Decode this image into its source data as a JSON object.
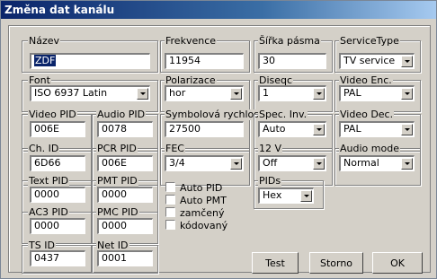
{
  "window": {
    "title": "Změna dat kanálu"
  },
  "fields": {
    "nazev": {
      "label": "Název",
      "value": "ZDF"
    },
    "frekvence": {
      "label": "Frekvence",
      "value": "11954"
    },
    "sirka": {
      "label": "Šířka pásma",
      "value": "30"
    },
    "servicetype": {
      "label": "ServiceType",
      "value": "TV service"
    },
    "font": {
      "label": "Font",
      "value": "ISO 6937 Latin"
    },
    "polarizace": {
      "label": "Polarizace",
      "value": "hor"
    },
    "diseqc": {
      "label": "Diseqc",
      "value": "1"
    },
    "videoenc": {
      "label": "Video Enc.",
      "value": "PAL"
    },
    "videopid": {
      "label": "Video PID",
      "value": "006E"
    },
    "audiopid": {
      "label": "Audio PID",
      "value": "0078"
    },
    "symbol": {
      "label": "Symbolová rychlost",
      "value": "27500"
    },
    "specinv": {
      "label": "Spec. Inv.",
      "value": "Auto"
    },
    "videodec": {
      "label": "Video Dec.",
      "value": "PAL"
    },
    "chid": {
      "label": "Ch. ID",
      "value": "6D66"
    },
    "pcrpid": {
      "label": "PCR PID",
      "value": "006E"
    },
    "fec": {
      "label": "FEC",
      "value": "3/4"
    },
    "v12": {
      "label": "12 V",
      "value": "Off"
    },
    "audiomode": {
      "label": "Audio mode",
      "value": "Normal"
    },
    "textpid": {
      "label": "Text PID",
      "value": "0000"
    },
    "pmtpid": {
      "label": "PMT PID",
      "value": "0000"
    },
    "ac3pid": {
      "label": "AC3 PID",
      "value": "0000"
    },
    "pmcpid": {
      "label": "PMC PID",
      "value": "0000"
    },
    "tsid": {
      "label": "TS ID",
      "value": "0437"
    },
    "netid": {
      "label": "Net ID",
      "value": "0001"
    },
    "pids": {
      "label": "PIDs",
      "value": "Hex"
    }
  },
  "checkboxes": {
    "autopid": "Auto PID",
    "autopmt": "Auto PMT",
    "zamceny": "zamčený",
    "kodovany": "kódovaný"
  },
  "buttons": {
    "test": "Test",
    "storno": "Storno",
    "ok": "OK"
  }
}
